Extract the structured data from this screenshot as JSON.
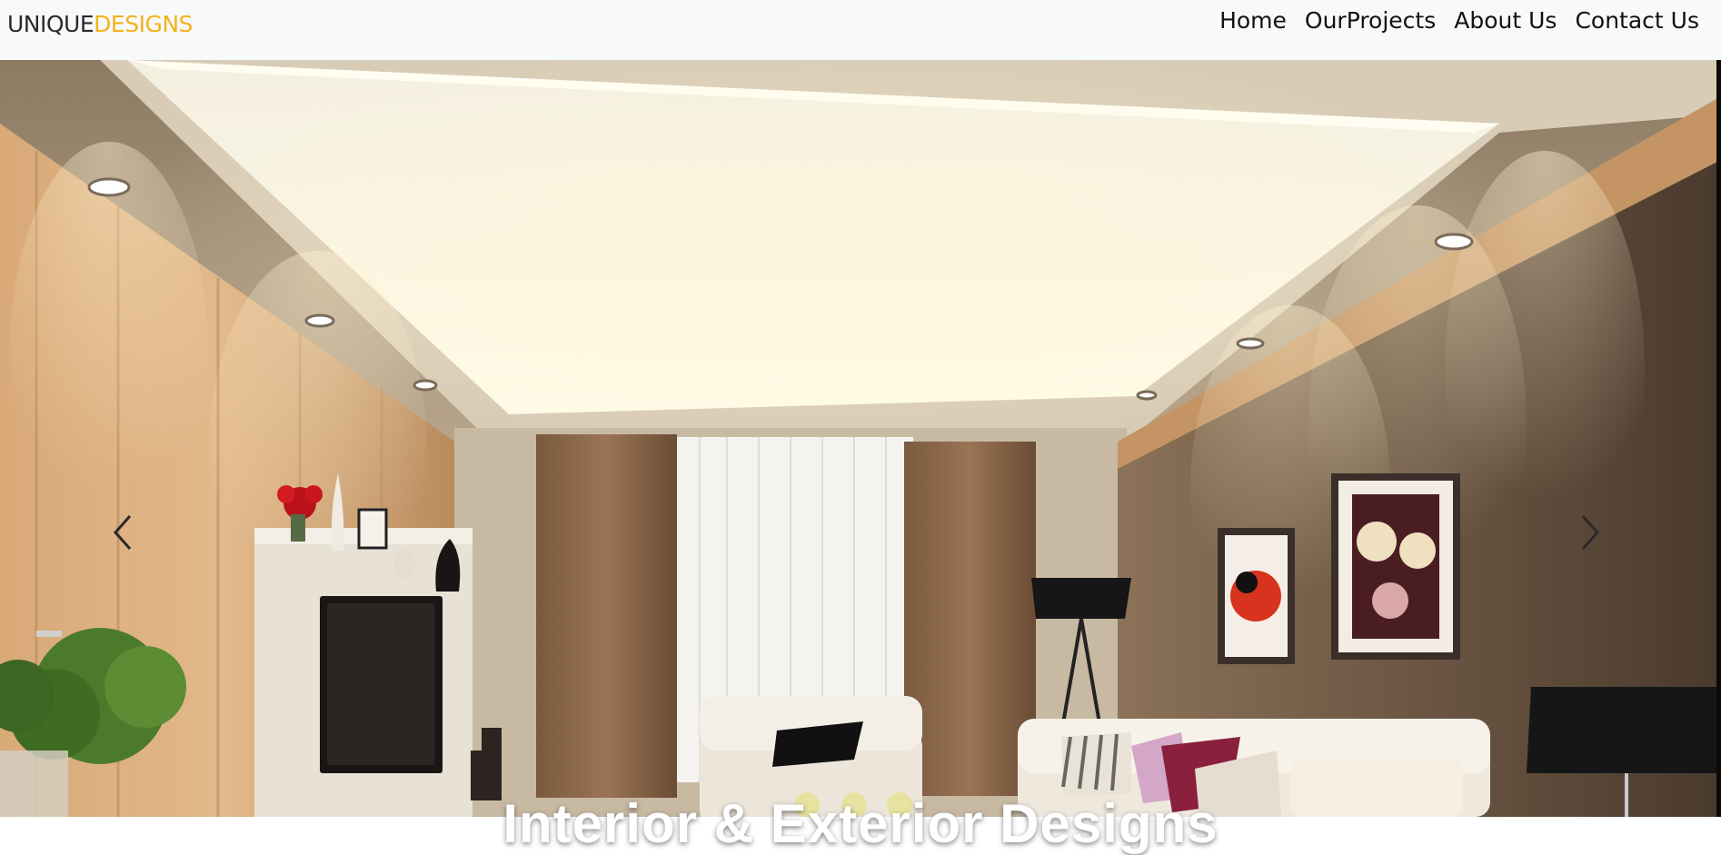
{
  "brand": {
    "part1": "UNIQUE",
    "part2": "DESIGNS"
  },
  "nav": {
    "items": [
      {
        "label": "Home"
      },
      {
        "label": "OurProjects"
      },
      {
        "label": "About Us"
      },
      {
        "label": "Contact Us"
      }
    ]
  },
  "hero": {
    "caption": "Interior & Exterior Designs",
    "prev_icon": "chevron-left-icon",
    "next_icon": "chevron-right-icon"
  },
  "colors": {
    "brand_accent": "#f5b21a",
    "navbar_bg": "#f8f9fb"
  }
}
